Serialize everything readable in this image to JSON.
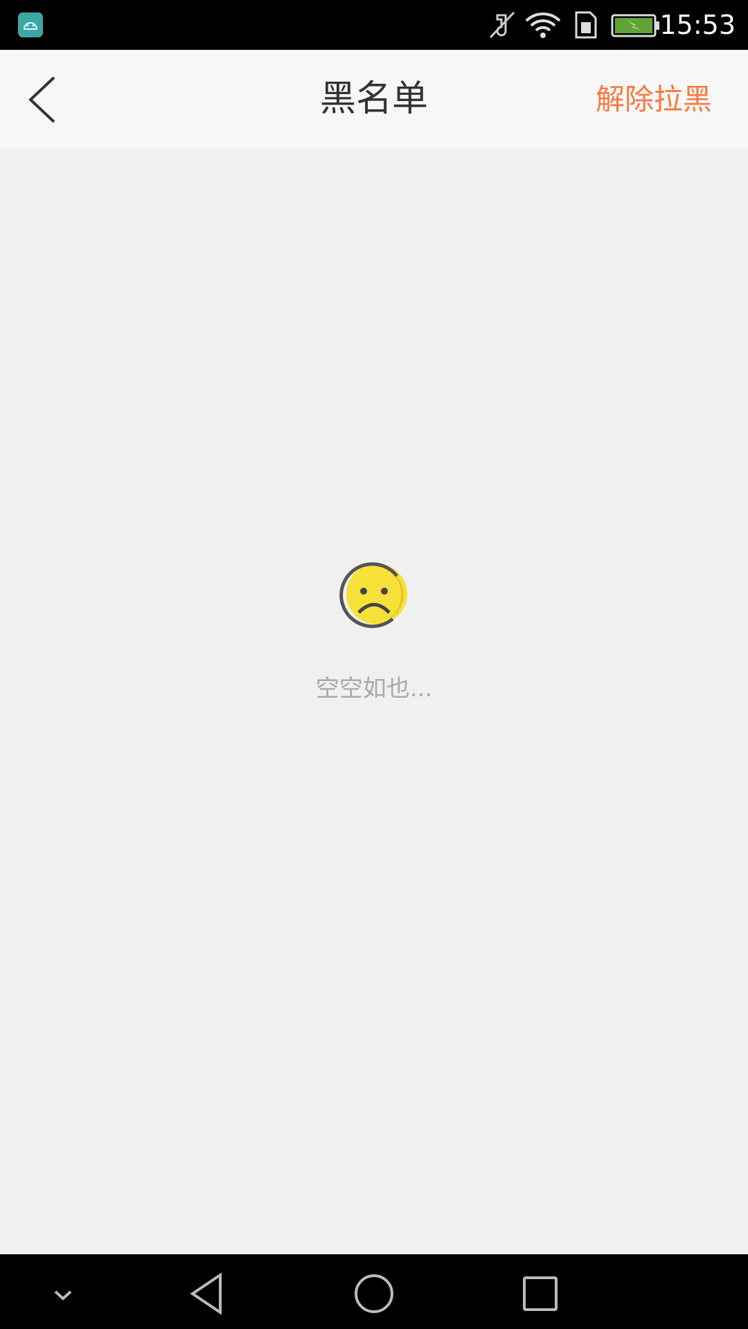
{
  "status_bar": {
    "time": "15:53",
    "icons": [
      "android-app-icon",
      "mute-icon",
      "wifi-icon",
      "sim-icon",
      "battery-charging-icon"
    ]
  },
  "header": {
    "title": "黑名单",
    "back_icon": "chevron-left-icon",
    "action_label": "解除拉黑",
    "action_color": "#f77a43"
  },
  "empty_state": {
    "icon": "sad-face-icon",
    "message": "空空如也..."
  },
  "nav_bar": {
    "icons": [
      "chevron-down-icon",
      "back-triangle-icon",
      "home-circle-icon",
      "recents-square-icon"
    ]
  }
}
